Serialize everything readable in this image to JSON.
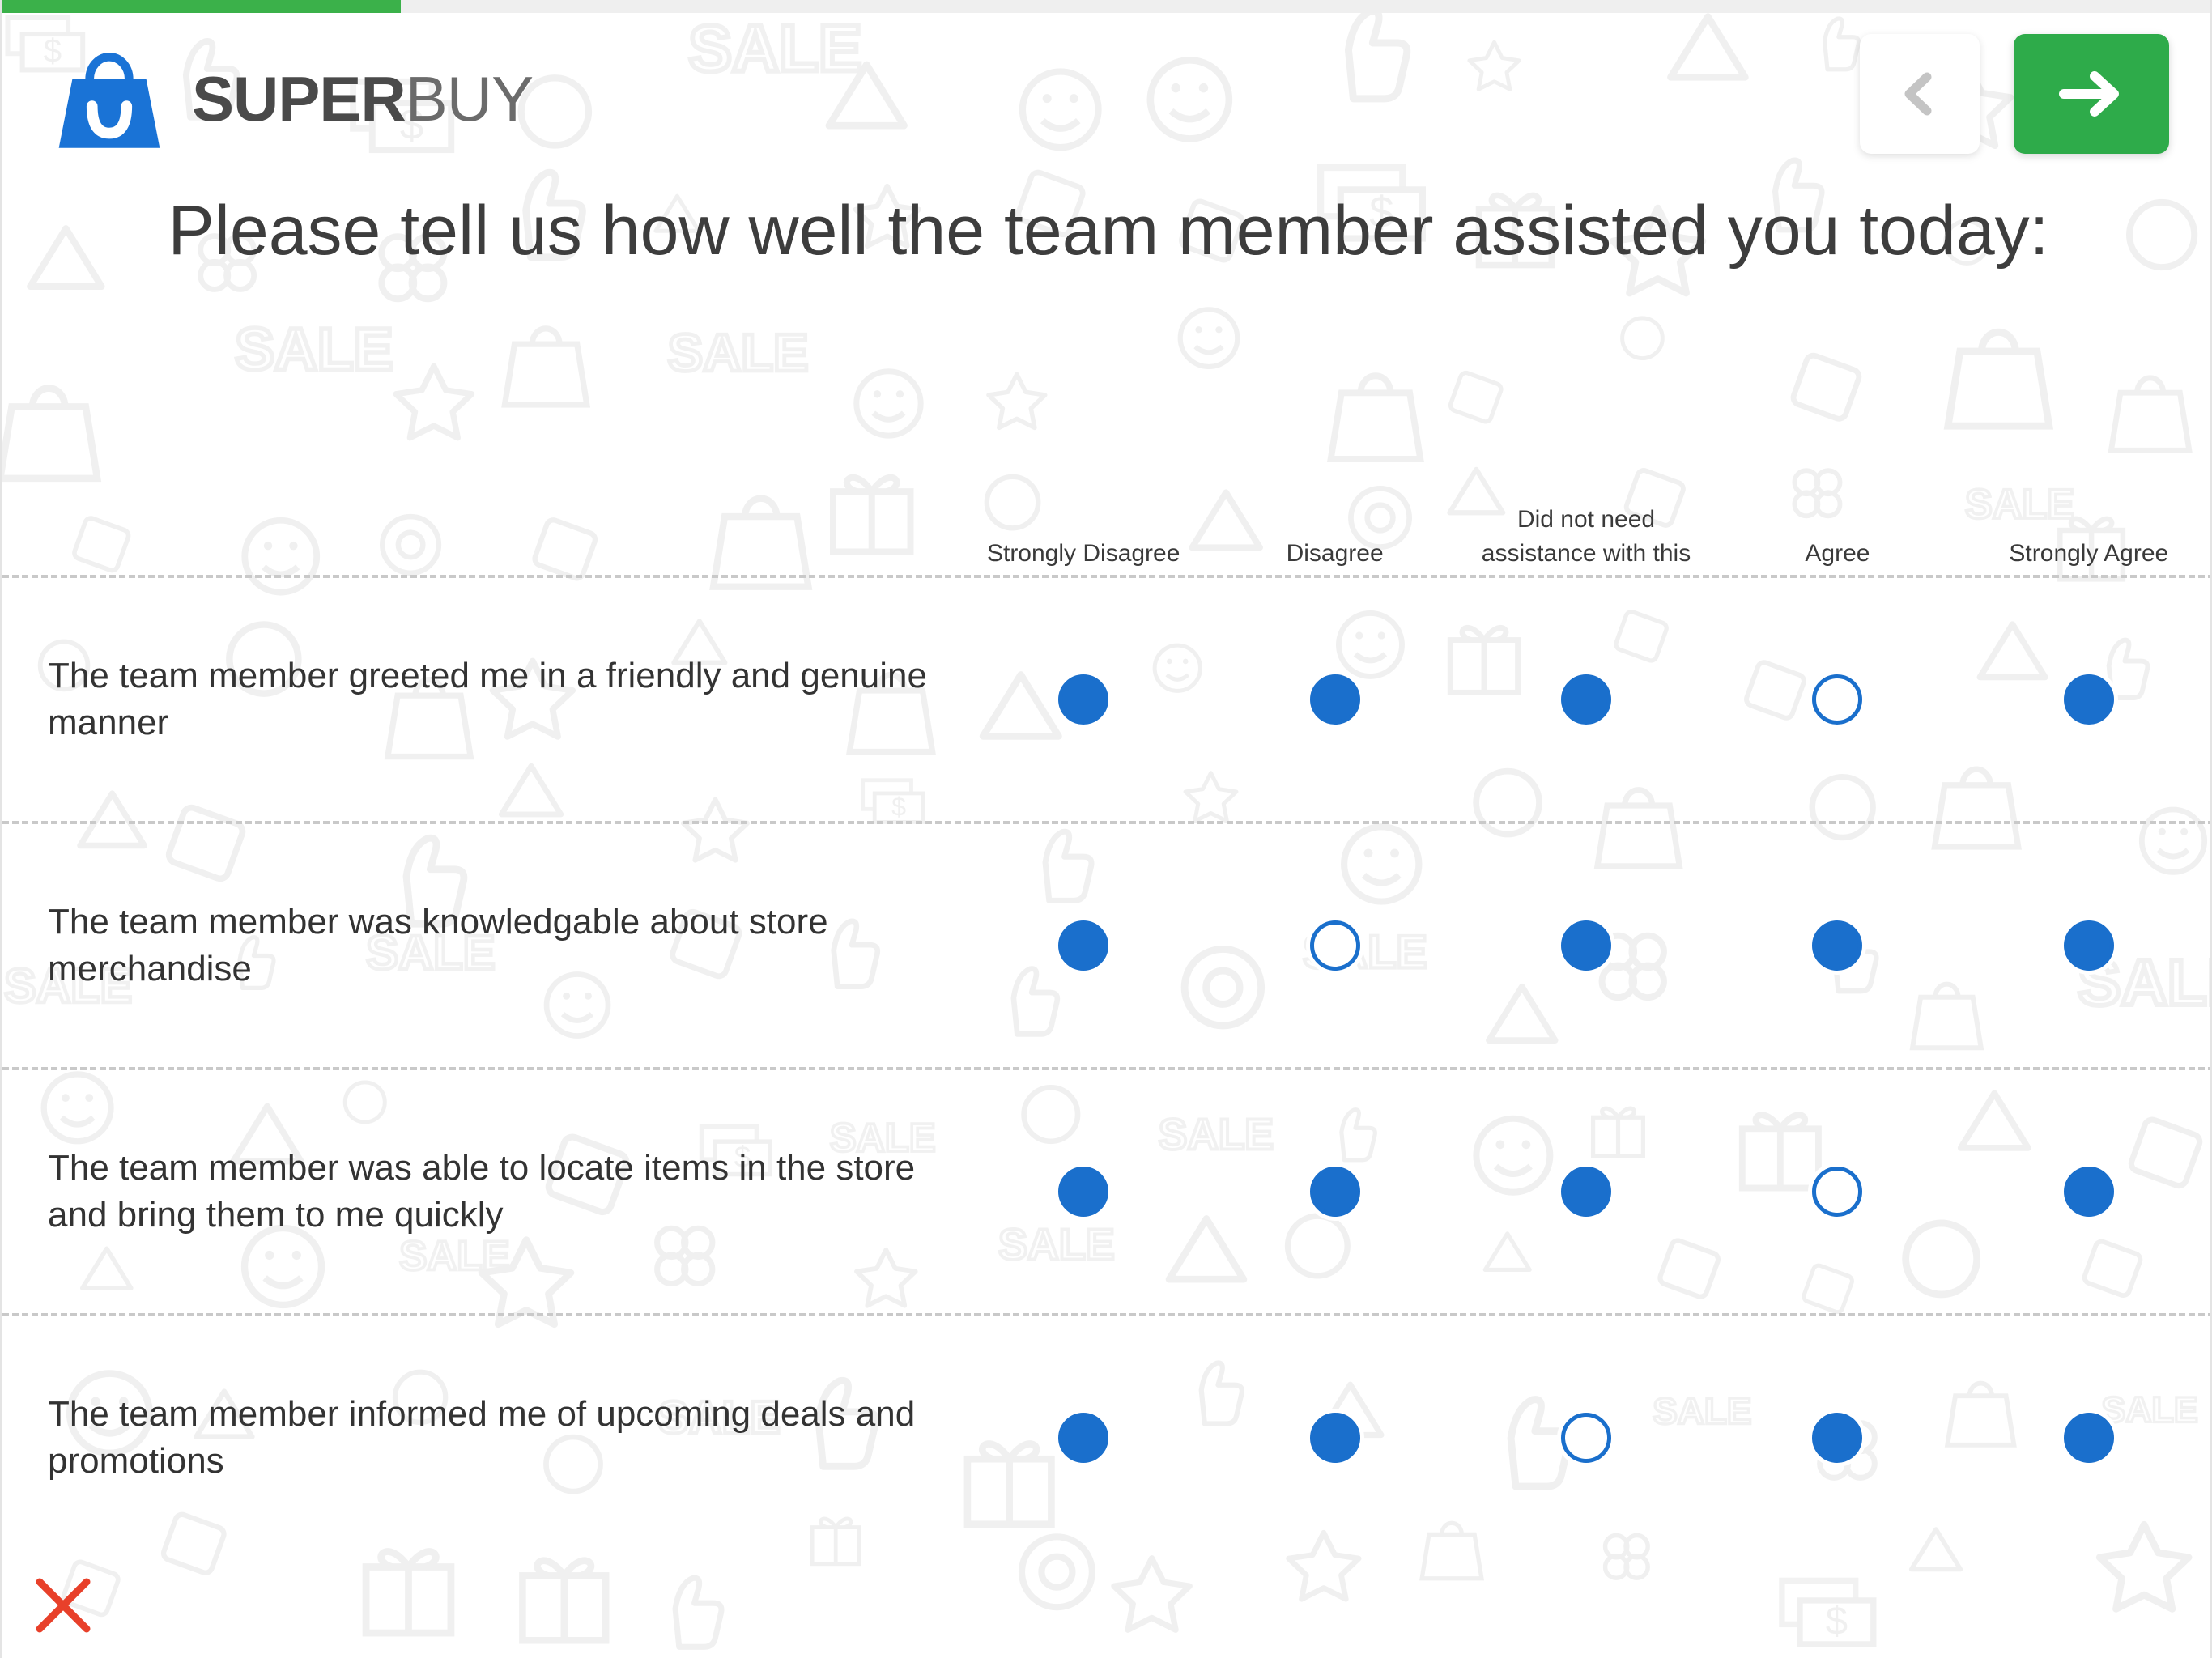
{
  "brand": {
    "name_bold": "SUPER",
    "name_light": "BUY",
    "logo_icon": "shopping-bag-smile-icon",
    "logo_color": "#1a73d6"
  },
  "progress": {
    "percent": 18,
    "fill_color": "#3bb14a",
    "track_color": "#efefef"
  },
  "header": {
    "back_label": "",
    "back_icon": "chevron-left-icon",
    "next_label": "",
    "next_icon": "arrow-right-icon",
    "next_color": "#2eab4a"
  },
  "question": {
    "title": "Please tell us how well the team member assisted you today:"
  },
  "matrix": {
    "columns": [
      "Strongly Disagree",
      "Disagree",
      "Did not need assistance with this",
      "Agree",
      "Strongly Agree"
    ],
    "rows": [
      {
        "label": "The team member greeted me in a friendly and genuine manner",
        "states": [
          "selected",
          "selected",
          "selected",
          "empty",
          "selected"
        ]
      },
      {
        "label": "The team member was knowledgable about store merchandise",
        "states": [
          "selected",
          "empty",
          "selected",
          "selected",
          "selected"
        ]
      },
      {
        "label": "The team member was able to locate items in the store and bring them to me quickly",
        "states": [
          "selected",
          "selected",
          "selected",
          "empty",
          "selected"
        ]
      },
      {
        "label": "The team member informed me of upcoming deals and promotions",
        "states": [
          "selected",
          "selected",
          "empty",
          "selected",
          "selected"
        ]
      }
    ],
    "radio_color": "#1a6fcc"
  },
  "footer": {
    "close_icon": "close-x-icon",
    "close_color": "#e8402a"
  },
  "watermark": {
    "text_glyph": "SALE",
    "icons": [
      "shopping-bag-icon",
      "gift-icon",
      "dollar-bill-icon",
      "smiley-icon",
      "flower-icon",
      "star-icon",
      "thumbs-up-icon",
      "target-icon",
      "play-triangle-icon",
      "circle-icon",
      "tag-icon"
    ],
    "color": "#f1f1f1"
  }
}
